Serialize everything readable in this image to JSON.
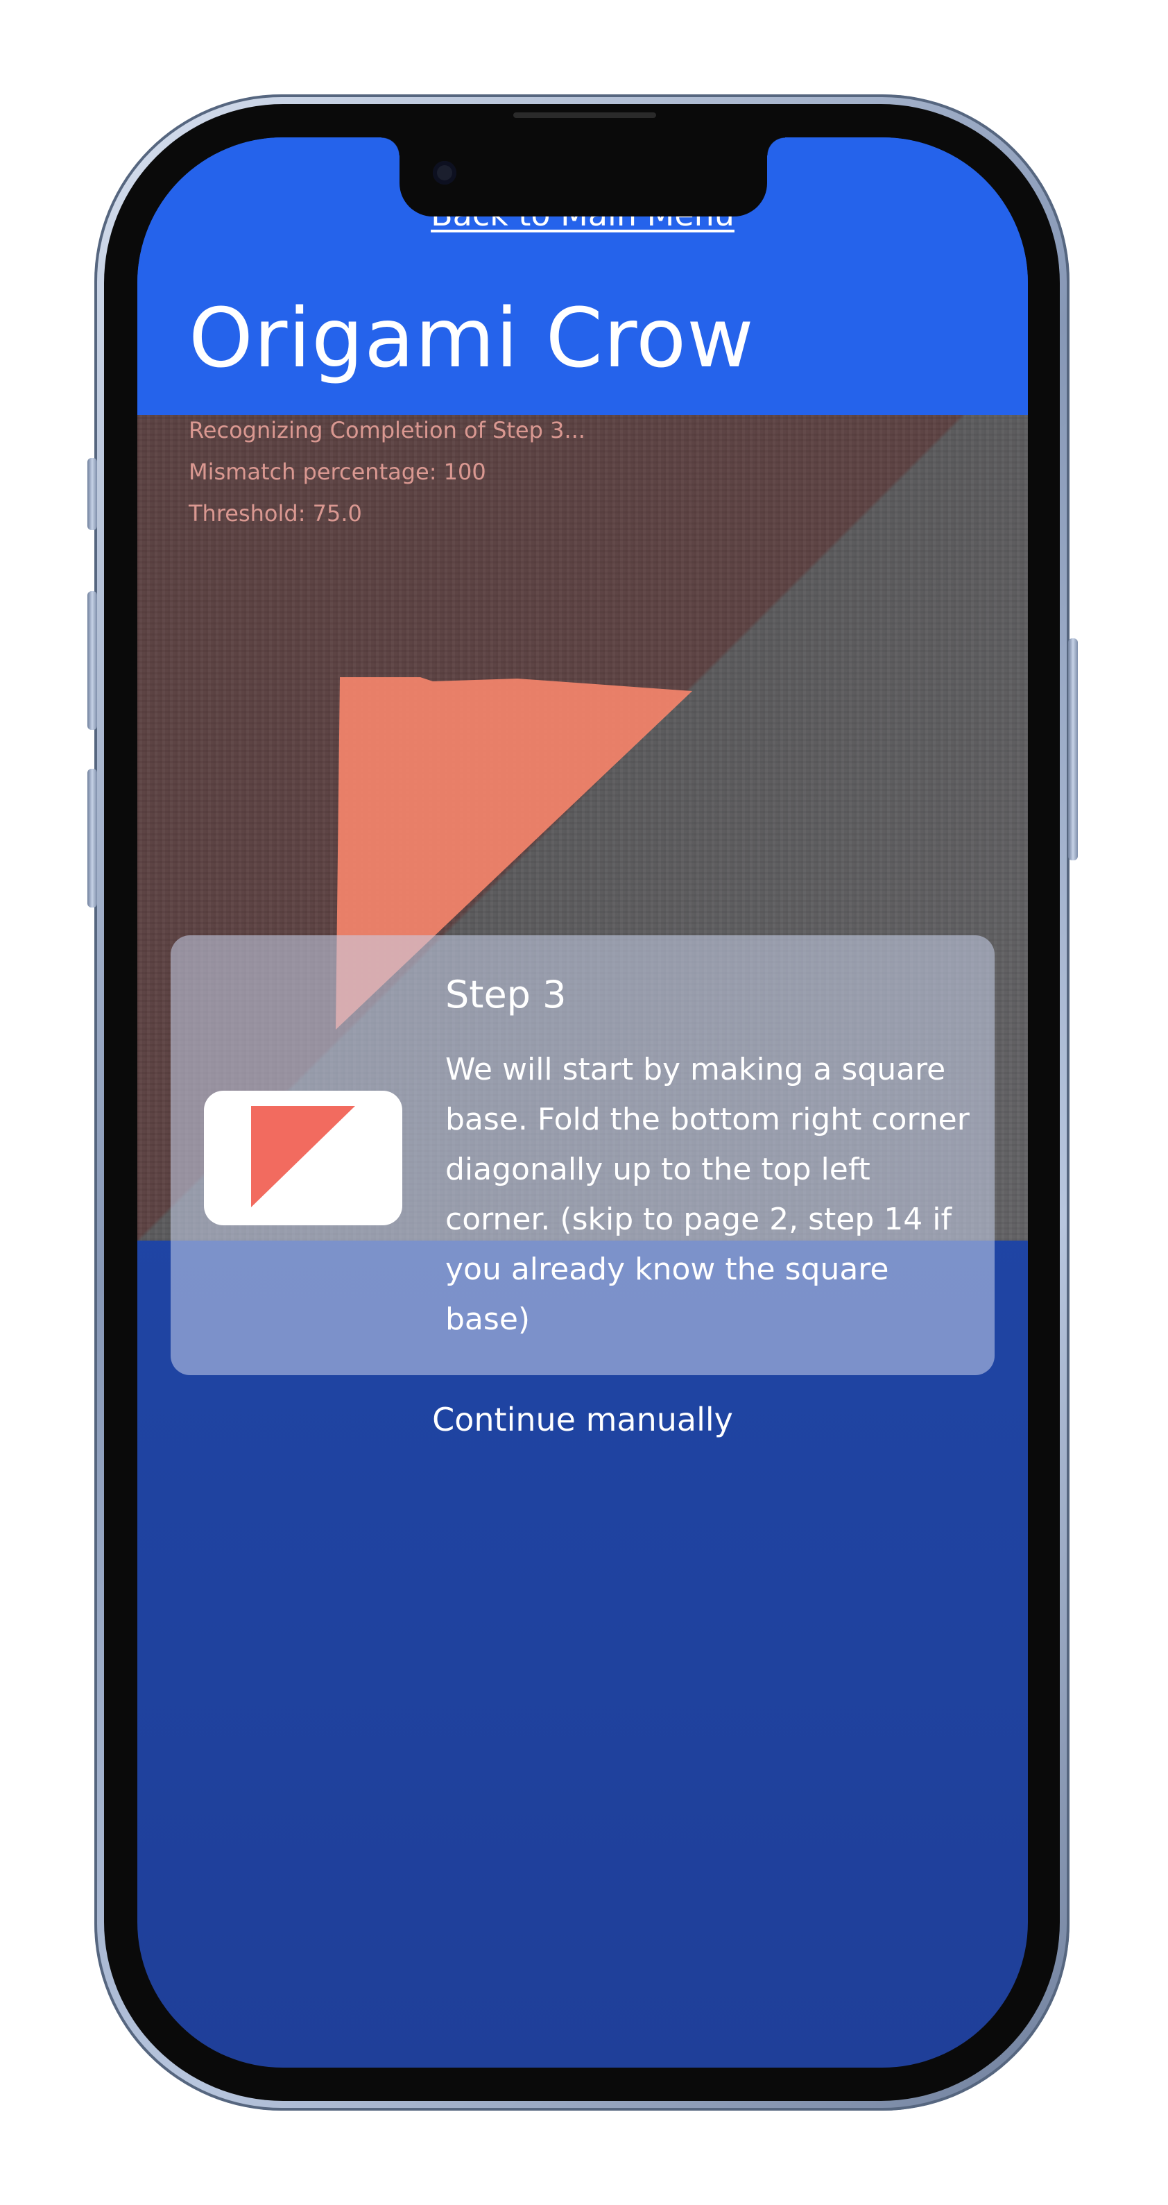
{
  "header": {
    "back_link": "Back to Main Menu",
    "title": "Origami Crow"
  },
  "status": {
    "line1": "Recognizing Completion of Step 3...",
    "line2": "Mismatch percentage: 100",
    "line3": "Threshold: 75.0"
  },
  "step_card": {
    "heading": "Step 3",
    "description": "We will start by making a square base. Fold the bottom right corner diagonally up to the top left corner. (skip to page 2, step 14 if you already know the square base)"
  },
  "actions": {
    "continue_label": "Continue manually"
  },
  "colors": {
    "accent": "#2563eb",
    "paper": "#f4846b",
    "thumb_triangle": "#f26b5f"
  },
  "icons": {
    "thumbnail": "folded-triangle-icon"
  }
}
